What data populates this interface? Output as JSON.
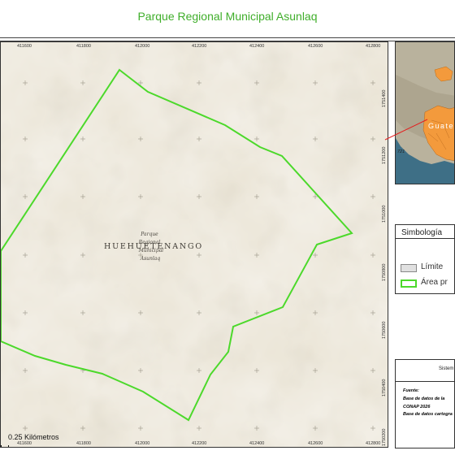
{
  "header": {
    "title": "Parque Regional Municipal Asunlaq",
    "title_color": "#3fae2a"
  },
  "map": {
    "background_color": "#e3dbc8",
    "boundary_color": "#4cd92b",
    "department_label": "HUEHUETENANGO",
    "park_label_lines": [
      "Parque",
      "Regional",
      "Municipal",
      "Asunlaq"
    ],
    "x_ticks": [
      "411600",
      "411800",
      "412000",
      "412200",
      "412400",
      "412600",
      "412800"
    ],
    "y_ticks": [
      "1751400",
      "1751200",
      "1751000",
      "1750800",
      "1750600",
      "1750400",
      "1750200"
    ],
    "scale_label": "0.25 Kilómetros"
  },
  "inset": {
    "label": "Guate",
    "code": "721",
    "highlight_color": "#f39a3c",
    "leader_color": "#e32020"
  },
  "legend": {
    "title": "Simbología",
    "items": [
      {
        "label": "Límite",
        "fill": "#e0e0e0",
        "stroke": "#888888"
      },
      {
        "label": "Área pr",
        "fill": "#ffffff",
        "stroke": "#4cd92b"
      }
    ]
  },
  "source": {
    "system_label": "Sistem",
    "label": "Fuente:",
    "lines": [
      "Base de datos de la",
      "CONAP 2026",
      "Base de datos cartogra"
    ]
  }
}
